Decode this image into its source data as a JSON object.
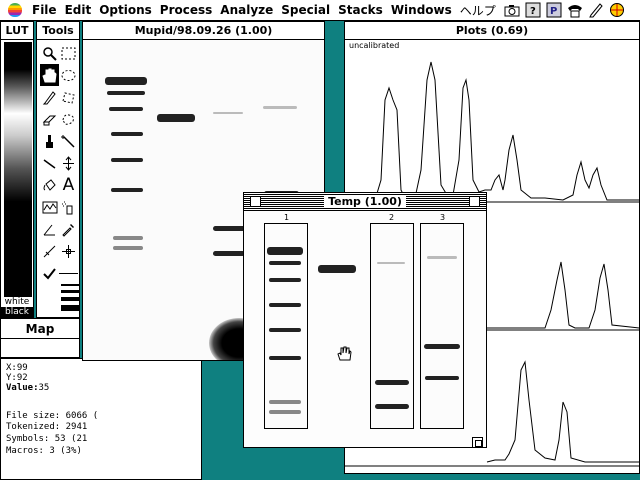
{
  "menubar": {
    "menus": [
      "File",
      "Edit",
      "Options",
      "Process",
      "Analyze",
      "Special",
      "Stacks",
      "Windows",
      "ヘルプ"
    ],
    "icons": [
      "camera-icon",
      "question-box-icon",
      "p-box-icon",
      "phone-icon",
      "pencil-icon",
      "globe-icon"
    ]
  },
  "lut": {
    "title": "LUT",
    "white_label": "white",
    "black_label": "black"
  },
  "tools": {
    "title": "Tools"
  },
  "map": {
    "title": "Map"
  },
  "info": {
    "x_label": "X:",
    "x_value": "99",
    "y_label": "Y:",
    "y_value": "92",
    "value_label": "Value:",
    "value_value": "35",
    "lines": [
      "File size: 6066 (",
      "Tokenized: 2941",
      "Symbols: 53 (21",
      "Macros: 3 (3%)"
    ]
  },
  "mupid": {
    "title": "Mupid/98.09.26 (1.00)"
  },
  "plots": {
    "title": "Plots (0.69)",
    "note": "uncalibrated"
  },
  "temp": {
    "title": "Temp (1.00)",
    "lanes": [
      "1",
      "2",
      "3"
    ]
  },
  "colors": {
    "desktop": "#0f8080",
    "window": "#ffffff",
    "ink": "#000000"
  }
}
